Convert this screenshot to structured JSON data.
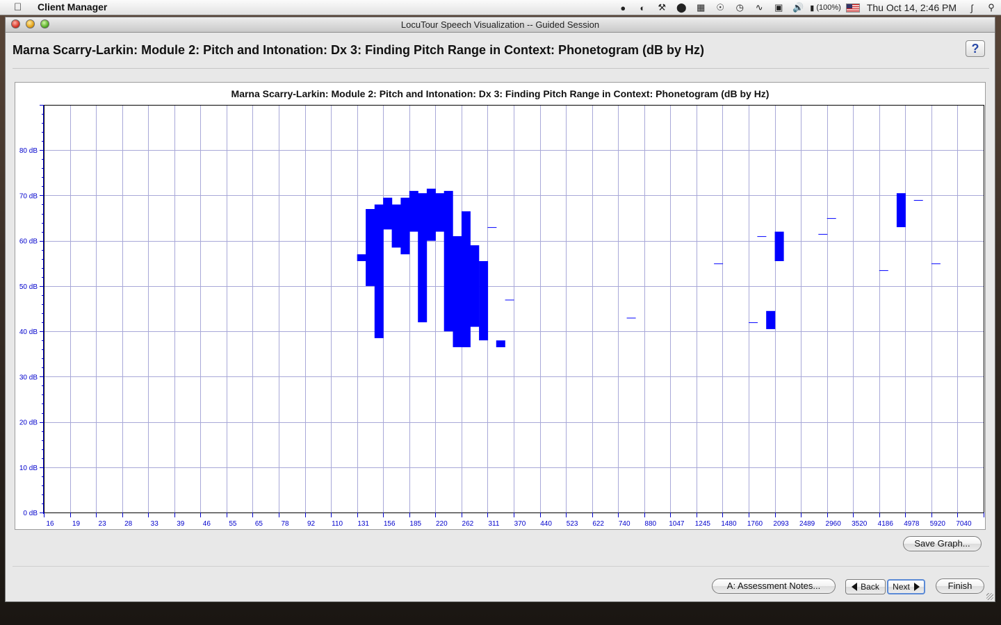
{
  "menubar": {
    "app_name": "Client Manager",
    "battery": "(100%)",
    "clock": "Thu Oct 14,  2:46 PM"
  },
  "window": {
    "title": "LocuTour Speech Visualization -- Guided Session",
    "header_title": "Marna Scarry-Larkin: Module 2: Pitch and Intonation: Dx 3: Finding Pitch Range in Context: Phonetogram (dB by Hz)",
    "help_label": "?"
  },
  "buttons": {
    "save_graph": "Save Graph...",
    "assessment_notes": "A: Assessment Notes...",
    "back": "Back",
    "next": "Next",
    "finish": "Finish"
  },
  "colors": {
    "plot": "#0000ff",
    "grid": "#a8a8d8",
    "axis_text": "#0000cc"
  },
  "chart_data": {
    "type": "heatmap",
    "title": "Marna Scarry-Larkin: Module 2: Pitch and Intonation: Dx 3: Finding Pitch Range in Context: Phonetogram (dB by Hz)",
    "x_ticks": [
      "16",
      "19",
      "23",
      "28",
      "33",
      "39",
      "46",
      "55",
      "65",
      "78",
      "92",
      "110",
      "131",
      "156",
      "185",
      "220",
      "262",
      "311",
      "370",
      "440",
      "523",
      "622",
      "740",
      "880",
      "1047",
      "1245",
      "1480",
      "1760",
      "2093",
      "2489",
      "2960",
      "3520",
      "4186",
      "4978",
      "5920",
      "7040"
    ],
    "y_ticks": [
      "0 dB",
      "10 dB",
      "20 dB",
      "30 dB",
      "40 dB",
      "50 dB",
      "60 dB",
      "70 dB",
      "80 dB"
    ],
    "ylim": [
      0,
      90
    ],
    "grid": true,
    "bars": [
      {
        "x": 12.0,
        "w": 0.33,
        "low": 55.5,
        "high": 57.0
      },
      {
        "x": 12.33,
        "w": 0.33,
        "low": 50.0,
        "high": 67.0
      },
      {
        "x": 12.67,
        "w": 0.33,
        "low": 38.5,
        "high": 68.0
      },
      {
        "x": 13.0,
        "w": 0.33,
        "low": 62.5,
        "high": 69.5
      },
      {
        "x": 13.33,
        "w": 0.33,
        "low": 58.5,
        "high": 68.0
      },
      {
        "x": 13.67,
        "w": 0.33,
        "low": 57.0,
        "high": 69.5
      },
      {
        "x": 14.0,
        "w": 0.33,
        "low": 62.0,
        "high": 71.0
      },
      {
        "x": 14.33,
        "w": 0.33,
        "low": 42.0,
        "high": 70.5
      },
      {
        "x": 14.67,
        "w": 0.33,
        "low": 60.0,
        "high": 71.5
      },
      {
        "x": 15.0,
        "w": 0.33,
        "low": 62.0,
        "high": 70.5
      },
      {
        "x": 15.33,
        "w": 0.33,
        "low": 40.0,
        "high": 71.0
      },
      {
        "x": 15.67,
        "w": 0.33,
        "low": 36.5,
        "high": 61.0
      },
      {
        "x": 16.0,
        "w": 0.33,
        "low": 36.5,
        "high": 66.5
      },
      {
        "x": 16.33,
        "w": 0.33,
        "low": 41.0,
        "high": 59.0
      },
      {
        "x": 16.67,
        "w": 0.33,
        "low": 38.0,
        "high": 55.5
      },
      {
        "x": 17.0,
        "w": 0.33,
        "low": 63.0,
        "high": 63.0
      },
      {
        "x": 17.33,
        "w": 0.33,
        "low": 36.5,
        "high": 38.0
      },
      {
        "x": 17.67,
        "w": 0.33,
        "low": 47.0,
        "high": 47.0
      },
      {
        "x": 22.33,
        "w": 0.33,
        "low": 43.0,
        "high": 43.0
      },
      {
        "x": 25.67,
        "w": 0.33,
        "low": 55.0,
        "high": 55.0
      },
      {
        "x": 27.0,
        "w": 0.33,
        "low": 42.0,
        "high": 42.0
      },
      {
        "x": 27.33,
        "w": 0.33,
        "low": 61.0,
        "high": 61.0
      },
      {
        "x": 27.67,
        "w": 0.33,
        "low": 40.5,
        "high": 44.5
      },
      {
        "x": 28.0,
        "w": 0.33,
        "low": 55.5,
        "high": 62.0
      },
      {
        "x": 29.67,
        "w": 0.33,
        "low": 61.5,
        "high": 61.5
      },
      {
        "x": 30.0,
        "w": 0.33,
        "low": 65.0,
        "high": 65.0
      },
      {
        "x": 32.0,
        "w": 0.33,
        "low": 53.5,
        "high": 53.5
      },
      {
        "x": 32.67,
        "w": 0.33,
        "low": 63.0,
        "high": 70.5
      },
      {
        "x": 33.33,
        "w": 0.33,
        "low": 69.0,
        "high": 69.0
      },
      {
        "x": 34.0,
        "w": 0.33,
        "low": 55.0,
        "high": 55.0
      }
    ]
  }
}
